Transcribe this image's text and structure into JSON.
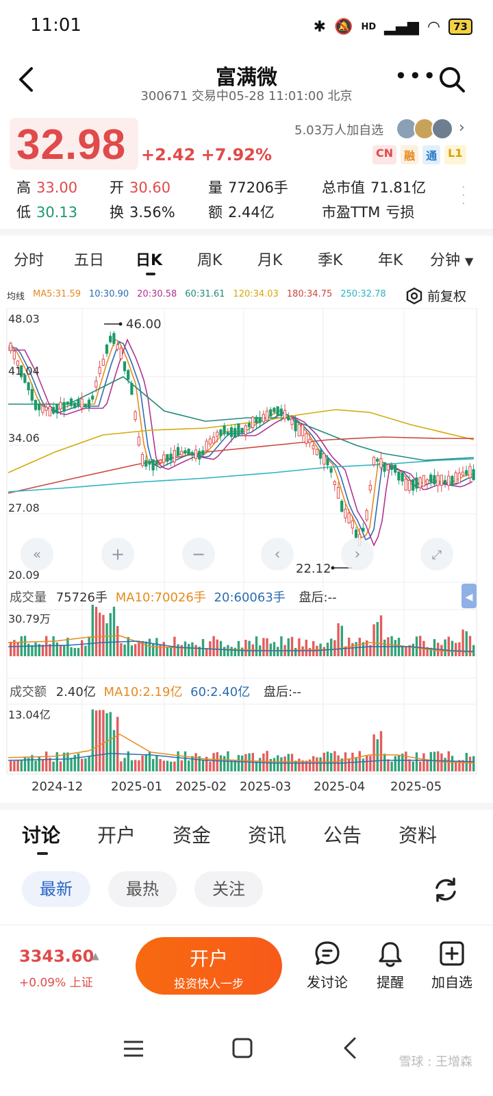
{
  "status_bar": {
    "time": "11:01",
    "network": "HD",
    "battery": "73"
  },
  "header": {
    "title": "富满微",
    "subtitle": "300671 交易中05-28 11:01:00 北京"
  },
  "price": {
    "current": "32.98",
    "change": "+2.42 +7.92%",
    "followers": "5.03万人加自选",
    "badges": [
      "CN",
      "融",
      "通",
      "L1"
    ]
  },
  "quote": {
    "high_label": "高",
    "high": "33.00",
    "open_label": "开",
    "open": "30.60",
    "volume_label": "量",
    "volume": "77206手",
    "market_cap_label": "总市值",
    "market_cap": "71.81亿",
    "low_label": "低",
    "low": "30.13",
    "turnover_label": "换",
    "turnover": "3.56%",
    "amount_label": "额",
    "amount": "2.44亿",
    "pe_label": "市盈TTM",
    "pe": "亏损"
  },
  "period_tabs": [
    "分时",
    "五日",
    "日K",
    "周K",
    "月K",
    "季K",
    "年K",
    "分钟"
  ],
  "active_period": "日K",
  "ma_legend": {
    "title": "均线",
    "items": [
      {
        "label": "MA5:31.59",
        "color": "#e58a1e"
      },
      {
        "label": "10:30.90",
        "color": "#2b6cb0"
      },
      {
        "label": "20:30.58",
        "color": "#b0338f"
      },
      {
        "label": "60:31.61",
        "color": "#1f8a7a"
      },
      {
        "label": "120:34.03",
        "color": "#d4a90a"
      },
      {
        "label": "180:34.75",
        "color": "#c9473f"
      },
      {
        "label": "250:32.78",
        "color": "#2bb3c0"
      }
    ],
    "adjust": "前复权"
  },
  "kline": {
    "y_labels": [
      "48.03",
      "41.04",
      "34.06",
      "27.08",
      "20.09"
    ],
    "high_marker": "46.00",
    "low_marker": "22.12"
  },
  "volume_panel": {
    "title": "成交量",
    "value": "75726手",
    "ma10": "MA10:70026手",
    "ma20": "20:60063手",
    "after_hours": "盘后:--",
    "y_label": "30.79万"
  },
  "amount_panel": {
    "title": "成交额",
    "value": "2.40亿",
    "ma10": "MA10:2.19亿",
    "ma60": "60:2.40亿",
    "after_hours": "盘后:--",
    "y_label": "13.04亿"
  },
  "x_labels": [
    "2024-12",
    "2025-01",
    "2025-02",
    "2025-03",
    "2025-04",
    "2025-05"
  ],
  "discussion_tabs": [
    "讨论",
    "开户",
    "资金",
    "资讯",
    "公告",
    "资料"
  ],
  "filters": [
    "最新",
    "最热",
    "关注"
  ],
  "bottom": {
    "index_value": "3343.60",
    "index_change": "+0.09% 上证",
    "open_title": "开户",
    "open_sub": "投资快人一步",
    "btn_discuss": "发讨论",
    "btn_remind": "提醒",
    "btn_watch": "加自选"
  },
  "watermark": "雪球 : 王增森"
}
